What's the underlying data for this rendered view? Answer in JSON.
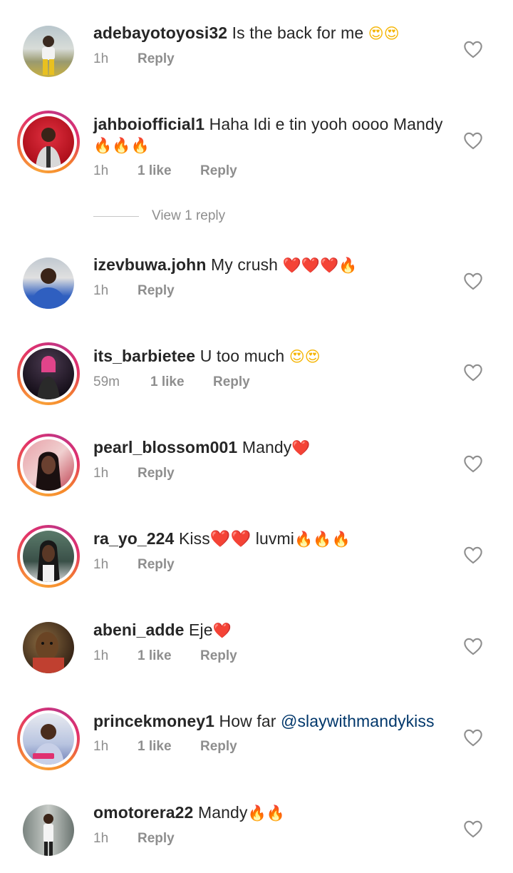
{
  "comments": [
    {
      "username": "adebayotoyosi32",
      "text": "Is the back for me",
      "emojis": "😍😍",
      "time": "1h",
      "likes": "",
      "reply": "Reply",
      "story_ring": false,
      "avatar_color": "#8aa0a8"
    },
    {
      "username": "jahboiofficial1",
      "text": "Haha Idi e tin yooh oooo Mandy",
      "emojis": "🔥🔥🔥",
      "time": "1h",
      "likes": "1 like",
      "reply": "Reply",
      "story_ring": true,
      "avatar_color": "#c7182b"
    },
    {
      "username": "izevbuwa.john",
      "text": "My crush",
      "emojis": "❤️❤️❤️🔥",
      "time": "1h",
      "likes": "",
      "reply": "Reply",
      "story_ring": false,
      "avatar_color": "#3b63b5"
    },
    {
      "username": "its_barbietee",
      "text": "U too much",
      "emojis": "😍😍",
      "time": "59m",
      "likes": "1 like",
      "reply": "Reply",
      "story_ring": true,
      "avatar_color": "#2a1f2e"
    },
    {
      "username": "pearl_blossom001",
      "text": "Mandy",
      "emojis": "❤️",
      "time": "1h",
      "likes": "",
      "reply": "Reply",
      "story_ring": true,
      "avatar_color": "#b0707a"
    },
    {
      "username": "ra_yo_224",
      "text": "Kiss❤️❤️ luvmi",
      "emojis": "🔥🔥🔥",
      "time": "1h",
      "likes": "",
      "reply": "Reply",
      "story_ring": true,
      "avatar_color": "#4d6b5a"
    },
    {
      "username": "abeni_adde",
      "text": "Eje",
      "emojis": "❤️",
      "time": "1h",
      "likes": "1 like",
      "reply": "Reply",
      "story_ring": false,
      "avatar_color": "#5a3a22"
    },
    {
      "username": "princekmoney1",
      "text": "How far",
      "mention": "@slaywithmandykiss",
      "emojis": "",
      "time": "1h",
      "likes": "1 like",
      "reply": "Reply",
      "story_ring": true,
      "avatar_color": "#6f7fb0"
    },
    {
      "username": "omotorera22",
      "text": "Mandy",
      "emojis": "🔥🔥",
      "time": "1h",
      "likes": "",
      "reply": "Reply",
      "story_ring": false,
      "avatar_color": "#9aa3a0"
    }
  ],
  "view_replies_label": "View 1 reply",
  "colors": {
    "text": "#262626",
    "meta": "#8e8e8e",
    "mention": "#00376b",
    "ring_start": "#f9a23b",
    "ring_end": "#c13584"
  }
}
